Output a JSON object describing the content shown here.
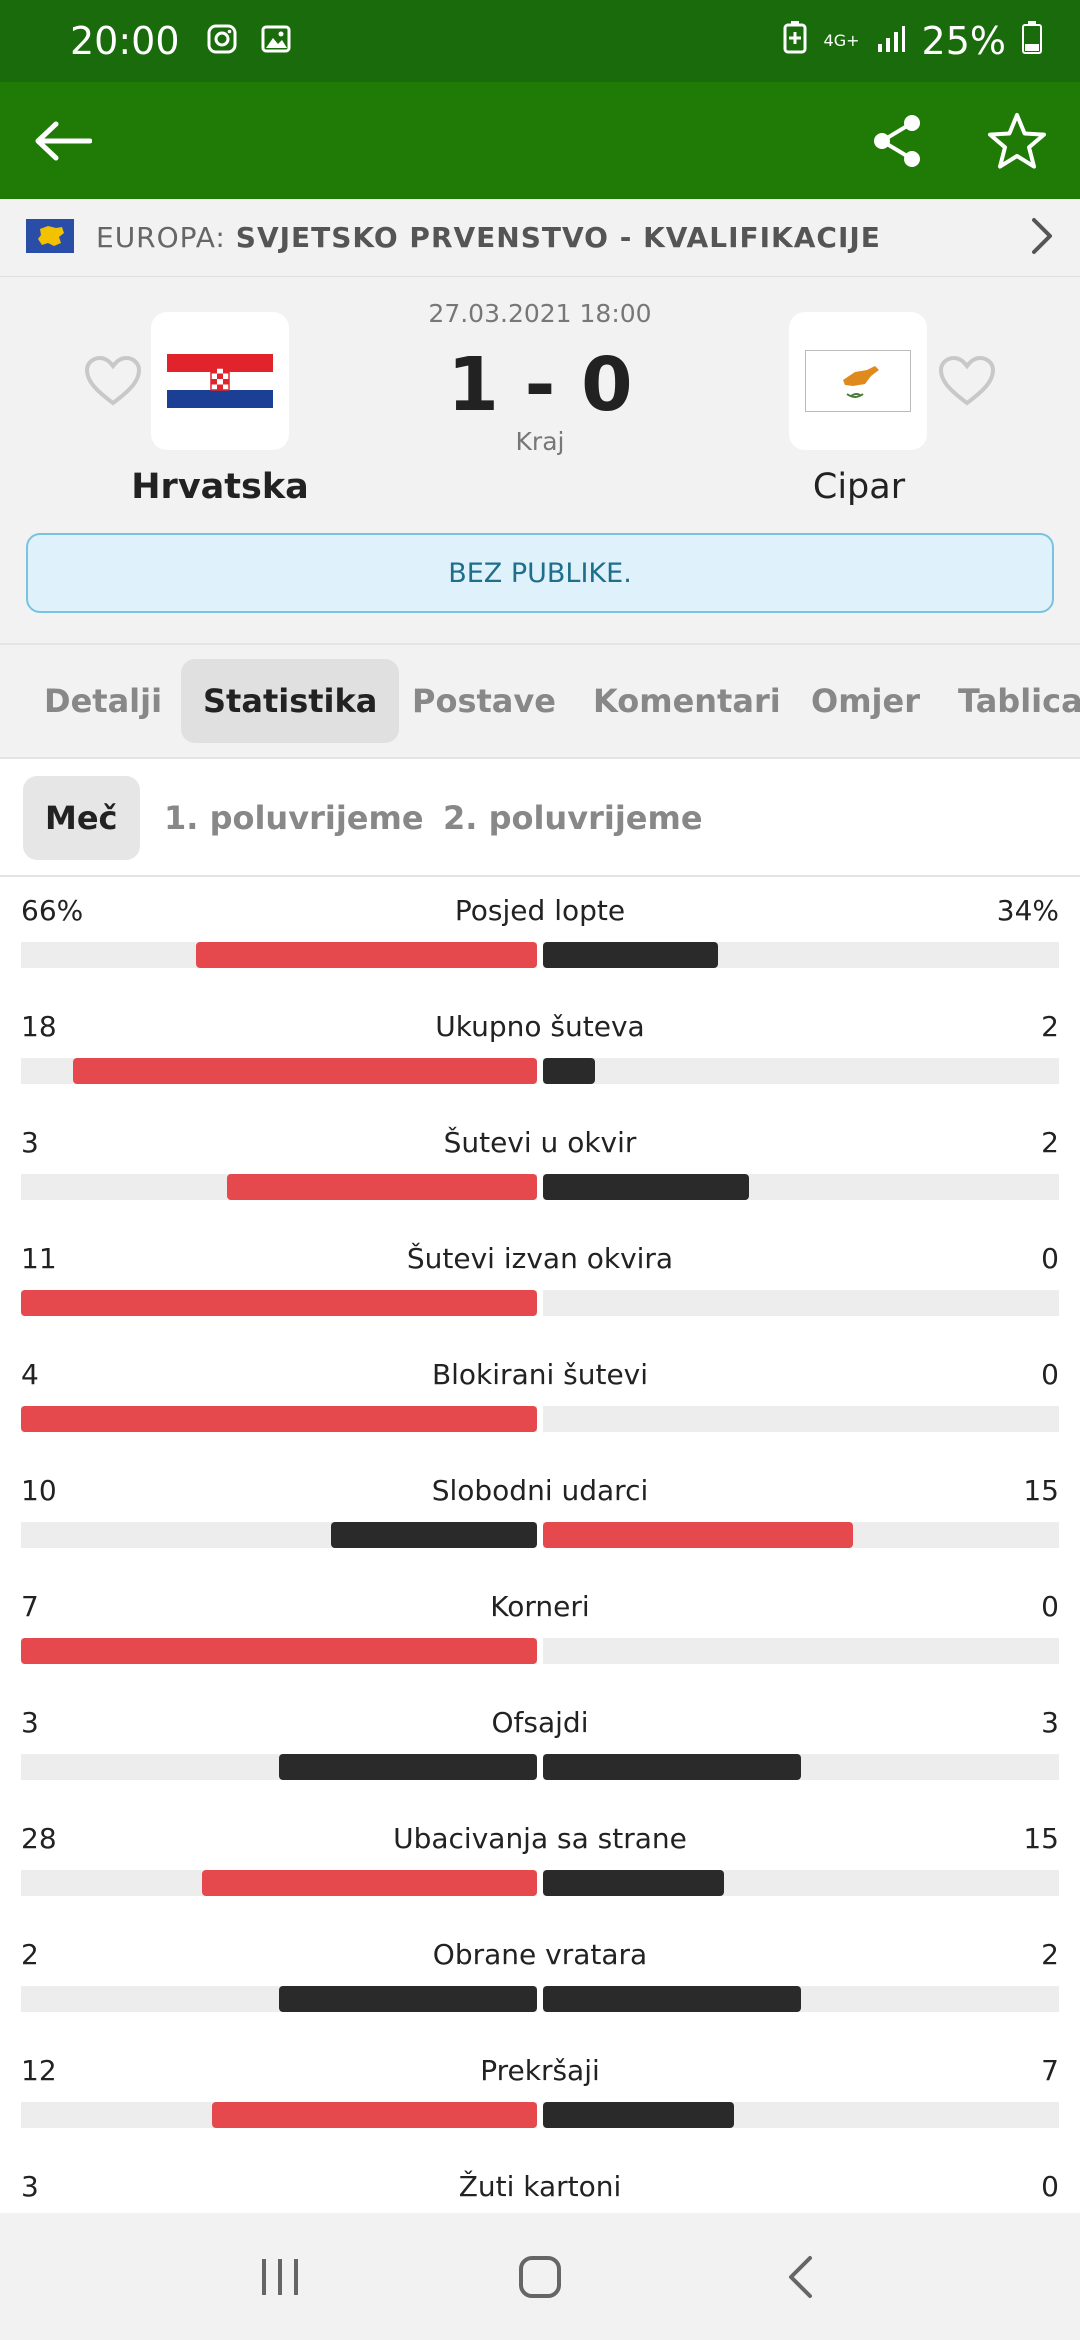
{
  "status_bar": {
    "time": "20:00",
    "network": "4G+",
    "battery": "25%"
  },
  "competition": {
    "region": "EUROPA:",
    "name": "SVJETSKO PRVENSTVO - KVALIFIKACIJE"
  },
  "match": {
    "date": "27.03.2021 18:00",
    "score": "1 - 0",
    "status": "Kraj",
    "home": {
      "name": "Hrvatska"
    },
    "away": {
      "name": "Cipar"
    },
    "notice": "BEZ PUBLIKE."
  },
  "tabs": [
    {
      "label": "Detalji"
    },
    {
      "label": "Statistika"
    },
    {
      "label": "Postave"
    },
    {
      "label": "Komentari"
    },
    {
      "label": "Omjer"
    },
    {
      "label": "Tablica"
    }
  ],
  "subtabs": [
    {
      "label": "Meč"
    },
    {
      "label": "1. poluvrijeme"
    },
    {
      "label": "2. poluvrijeme"
    }
  ],
  "colors": {
    "leader": "#e5484d",
    "trailer": "#2a2a2a",
    "track": "#ededed",
    "brand": "#1f7a06"
  },
  "stats": [
    {
      "label": "Posjed lopte",
      "home": "66%",
      "away": "34%",
      "home_frac": 0.66,
      "away_frac": 0.34,
      "home_leads": true,
      "away_leads": false
    },
    {
      "label": "Ukupno šuteva",
      "home": "18",
      "away": "2",
      "home_frac": 0.9,
      "away_frac": 0.1,
      "home_leads": true,
      "away_leads": false
    },
    {
      "label": "Šutevi u okvir",
      "home": "3",
      "away": "2",
      "home_frac": 0.6,
      "away_frac": 0.4,
      "home_leads": true,
      "away_leads": false
    },
    {
      "label": "Šutevi izvan okvira",
      "home": "11",
      "away": "0",
      "home_frac": 1.0,
      "away_frac": 0.0,
      "home_leads": true,
      "away_leads": false
    },
    {
      "label": "Blokirani šutevi",
      "home": "4",
      "away": "0",
      "home_frac": 1.0,
      "away_frac": 0.0,
      "home_leads": true,
      "away_leads": false
    },
    {
      "label": "Slobodni udarci",
      "home": "10",
      "away": "15",
      "home_frac": 0.4,
      "away_frac": 0.6,
      "home_leads": false,
      "away_leads": true
    },
    {
      "label": "Korneri",
      "home": "7",
      "away": "0",
      "home_frac": 1.0,
      "away_frac": 0.0,
      "home_leads": true,
      "away_leads": false
    },
    {
      "label": "Ofsajdi",
      "home": "3",
      "away": "3",
      "home_frac": 0.5,
      "away_frac": 0.5,
      "home_leads": false,
      "away_leads": false
    },
    {
      "label": "Ubacivanja sa strane",
      "home": "28",
      "away": "15",
      "home_frac": 0.65,
      "away_frac": 0.35,
      "home_leads": true,
      "away_leads": false
    },
    {
      "label": "Obrane vratara",
      "home": "2",
      "away": "2",
      "home_frac": 0.5,
      "away_frac": 0.5,
      "home_leads": false,
      "away_leads": false
    },
    {
      "label": "Prekršaji",
      "home": "12",
      "away": "7",
      "home_frac": 0.63,
      "away_frac": 0.37,
      "home_leads": true,
      "away_leads": false
    },
    {
      "label": "Žuti kartoni",
      "home": "3",
      "away": "0",
      "home_frac": 1.0,
      "away_frac": 0.0,
      "home_leads": true,
      "away_leads": false
    }
  ]
}
